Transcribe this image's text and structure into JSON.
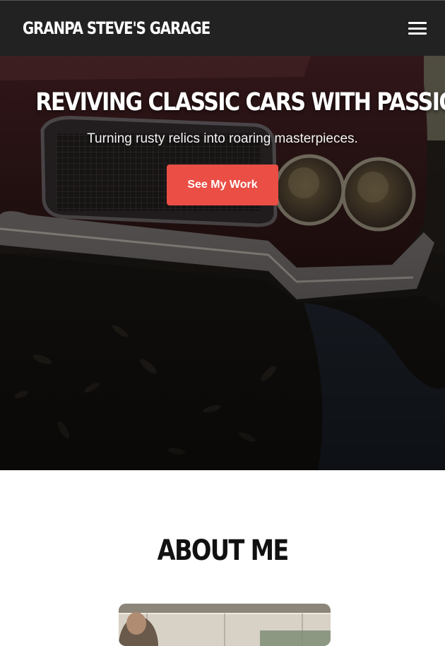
{
  "nav": {
    "brand": "GRANPA STEVE'S GARAGE",
    "menu_icon": "hamburger-menu-icon"
  },
  "hero": {
    "title": "REVIVING CLASSIC CARS WITH PASSION",
    "subtitle": "Turning rusty relics into roaring masterpieces.",
    "cta_label": "See My Work",
    "cta_color": "#ea4e45"
  },
  "about": {
    "title": "ABOUT ME"
  },
  "colors": {
    "navbar_bg": "#222222",
    "text_light": "#ffffff",
    "text_dark": "#111111"
  }
}
